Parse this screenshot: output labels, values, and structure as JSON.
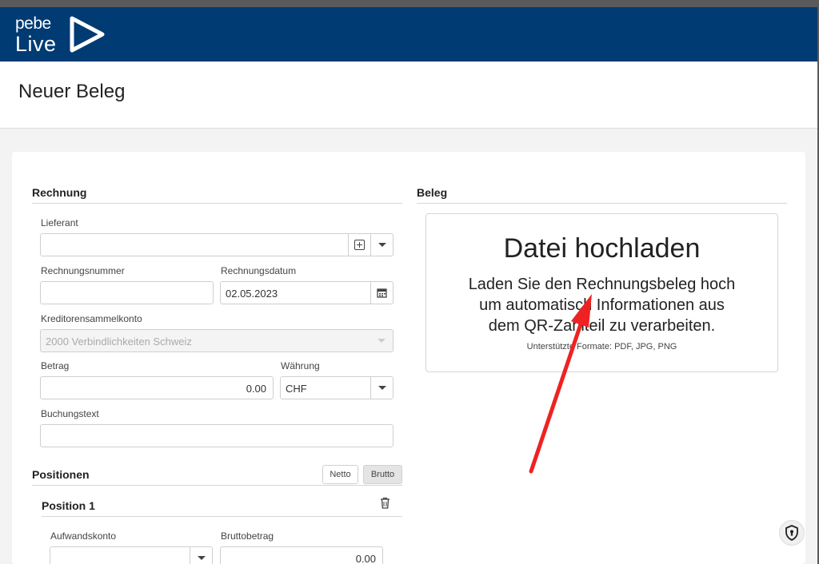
{
  "header": {
    "logo_top": "pebe",
    "logo_bottom": "Live"
  },
  "page": {
    "title": "Neuer Beleg"
  },
  "rechnung": {
    "title": "Rechnung",
    "lieferant_label": "Lieferant",
    "lieferant_value": "",
    "rechnungsnummer_label": "Rechnungsnummer",
    "rechnungsnummer_value": "",
    "rechnungsdatum_label": "Rechnungsdatum",
    "rechnungsdatum_value": "02.05.2023",
    "kreditor_label": "Kreditorensammelkonto",
    "kreditor_value": "2000 Verbindlichkeiten Schweiz",
    "betrag_label": "Betrag",
    "betrag_value": "0.00",
    "waehrung_label": "Währung",
    "waehrung_value": "CHF",
    "buchungstext_label": "Buchungstext",
    "buchungstext_value": ""
  },
  "positionen": {
    "title": "Positionen",
    "netto_label": "Netto",
    "brutto_label": "Brutto",
    "position_title": "Position 1",
    "aufwandskonto_label": "Aufwandskonto",
    "aufwandskonto_value": "",
    "bruttobetrag_label": "Bruttobetrag",
    "bruttobetrag_value": "0.00"
  },
  "beleg": {
    "title": "Beleg",
    "upload_title": "Datei hochladen",
    "upload_line1": "Laden Sie den Rechnungsbeleg hoch",
    "upload_line2": "um automatisch Informationen aus",
    "upload_line3": "dem QR-Zahlteil zu verarbeiten.",
    "upload_formats": "Unterstützte Formate: PDF, JPG, PNG"
  },
  "colors": {
    "header_bg": "#003b73",
    "annotation_arrow": "#ee2222"
  },
  "icons": [
    "logo-play-icon",
    "plus-box-icon",
    "chevron-down-icon",
    "calendar-icon",
    "trash-icon",
    "shield-keyhole-icon"
  ]
}
